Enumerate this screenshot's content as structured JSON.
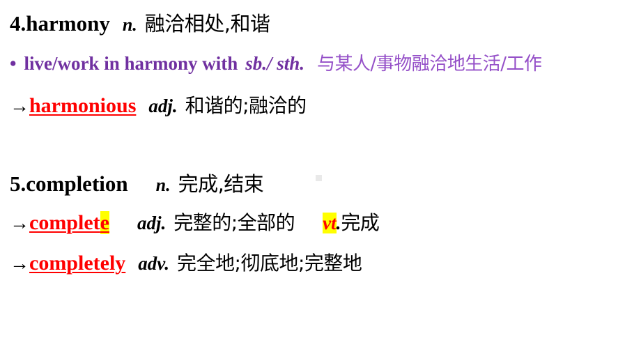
{
  "slide": {
    "background_color": "#ffffff",
    "colors": {
      "black": "#000000",
      "red": "#ff0000",
      "purple": "#7030a0",
      "purple_light": "#9550c8",
      "highlight_yellow": "#ffff00"
    }
  },
  "entries": [
    {
      "index": "4.",
      "headword": "harmony",
      "part_of_speech": "n.",
      "definition_cn": "融洽相处,和谐",
      "phrase": {
        "bullet": "•",
        "english_main": "live/work in harmony with",
        "english_italic": "sb./ sth.",
        "meaning_cn": "与某人/事物融洽地生活/工作"
      },
      "derivatives": [
        {
          "arrow": "→",
          "word": "harmonious",
          "part_of_speech": "adj.",
          "meaning_cn": "和谐的;融洽的",
          "highlighted": false
        }
      ]
    },
    {
      "index": "5.",
      "headword": "completion",
      "part_of_speech": "n.",
      "definition_cn": "完成,结束",
      "derivatives": [
        {
          "arrow": "→",
          "word_plain": "complet",
          "word_highlighted": "e",
          "part_of_speech": "adj.",
          "meaning_cn": "完整的;全部的",
          "extra_pos": "vt",
          "extra_pos_dot": ".",
          "extra_meaning_cn": "完成"
        },
        {
          "arrow": "→",
          "word": "completely",
          "part_of_speech": "adv.",
          "meaning_cn": "完全地;彻底地;完整地"
        }
      ]
    }
  ]
}
